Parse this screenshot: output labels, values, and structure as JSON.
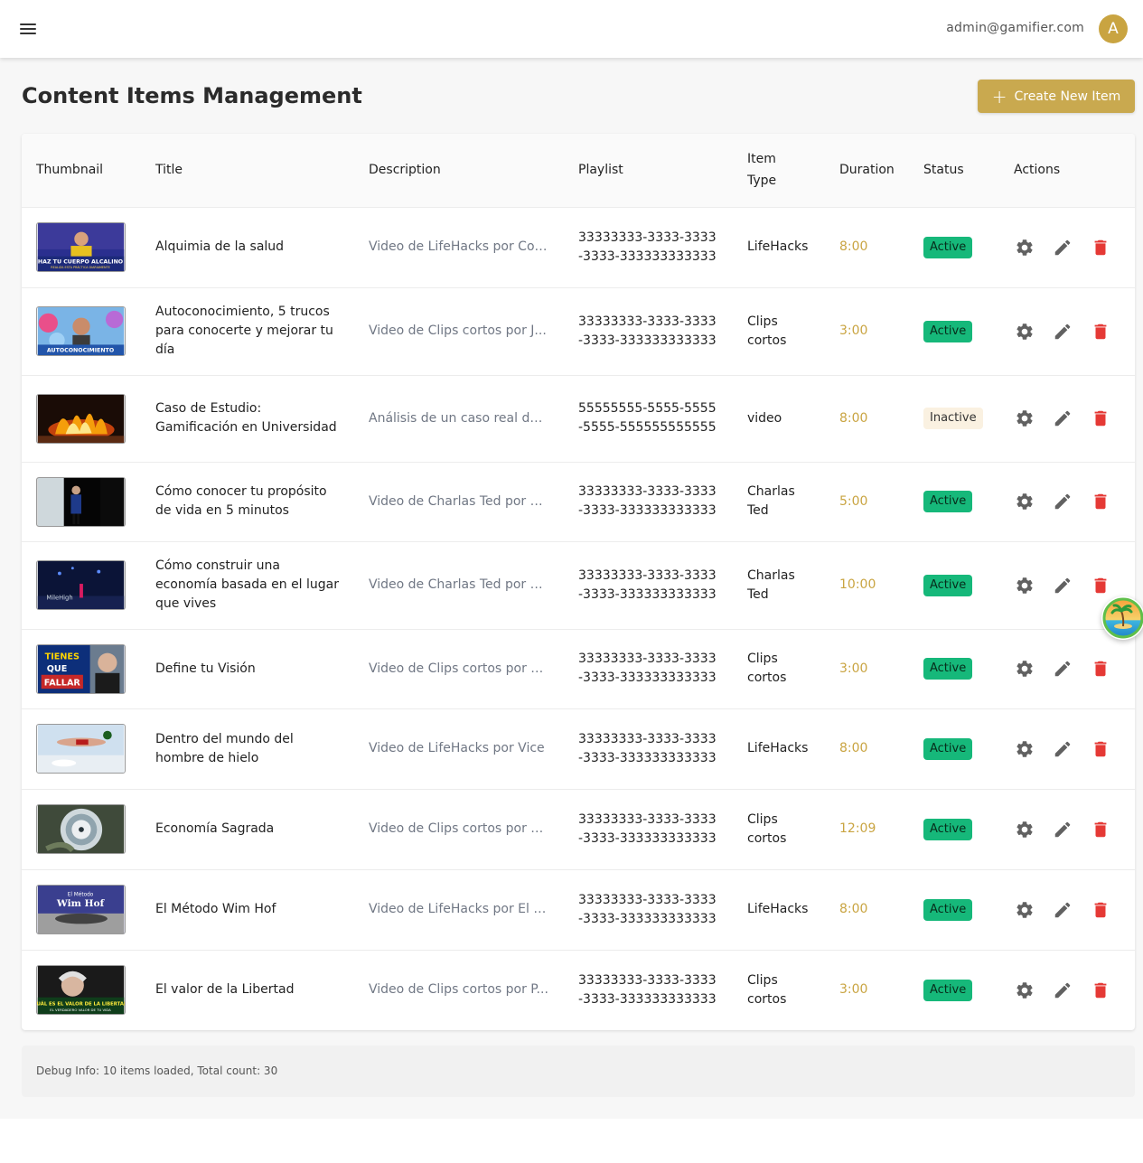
{
  "header": {
    "user_email": "admin@gamifier.com",
    "avatar_initial": "A",
    "menu_icon": "hamburger-menu-icon"
  },
  "page": {
    "title": "Content Items Management",
    "create_button_label": "Create New Item",
    "create_button_icon": "plus-icon"
  },
  "table": {
    "columns": [
      "Thumbnail",
      "Title",
      "Description",
      "Playlist",
      "Item Type",
      "Duration",
      "Status",
      "Actions"
    ],
    "actions_icons": [
      "gear-icon",
      "pencil-icon",
      "trash-icon"
    ],
    "rows": [
      {
        "title": "Alquimia de la salud",
        "description": "Video de LifeHacks por Con...",
        "playlist": "33333333-3333-3333-3333-333333333333",
        "item_type": "LifeHacks",
        "duration": "8:00",
        "status": "Active",
        "thumb_caption": "HAZ TU CUERPO ALCALINO"
      },
      {
        "title": "Autoconocimiento, 5 trucos para conocerte y mejorar tu día",
        "description": "Video de Clips cortos por J...",
        "playlist": "33333333-3333-3333-3333-333333333333",
        "item_type": "Clips cortos",
        "duration": "3:00",
        "status": "Active",
        "thumb_caption": "AUTOCONOCIMIENTO"
      },
      {
        "title": "Caso de Estudio: Gamificación en Universidad",
        "description": "Análisis de un caso real de ...",
        "playlist": "55555555-5555-5555-5555-555555555555",
        "item_type": "video",
        "duration": "8:00",
        "status": "Inactive",
        "thumb_caption": ""
      },
      {
        "title": "Cómo conocer tu propósito de vida en 5 minutos",
        "description": "Video de Charlas Ted por A...",
        "playlist": "33333333-3333-3333-3333-333333333333",
        "item_type": "Charlas Ted",
        "duration": "5:00",
        "status": "Active",
        "thumb_caption": ""
      },
      {
        "title": "Cómo construir una economía basada en el lugar que vives",
        "description": "Video de Charlas Ted por E...",
        "playlist": "33333333-3333-3333-3333-333333333333",
        "item_type": "Charlas Ted",
        "duration": "10:00",
        "status": "Active",
        "thumb_caption": "MileHigh"
      },
      {
        "title": "Define tu Visión",
        "description": "Video de Clips cortos por C...",
        "playlist": "33333333-3333-3333-3333-333333333333",
        "item_type": "Clips cortos",
        "duration": "3:00",
        "status": "Active",
        "thumb_caption": "TIENES QUE FALLAR"
      },
      {
        "title": "Dentro del mundo del hombre de hielo",
        "description": "Video de LifeHacks por Vice",
        "playlist": "33333333-3333-3333-3333-333333333333",
        "item_type": "LifeHacks",
        "duration": "8:00",
        "status": "Active",
        "thumb_caption": ""
      },
      {
        "title": "Economía Sagrada",
        "description": "Video de Clips cortos por C...",
        "playlist": "33333333-3333-3333-3333-333333333333",
        "item_type": "Clips cortos",
        "duration": "12:09",
        "status": "Active",
        "thumb_caption": ""
      },
      {
        "title": "El Método Wim Hof",
        "description": "Video de LifeHacks por El S...",
        "playlist": "33333333-3333-3333-3333-333333333333",
        "item_type": "LifeHacks",
        "duration": "8:00",
        "status": "Active",
        "thumb_caption": "Wim Hof"
      },
      {
        "title": "El valor de la Libertad",
        "description": "Video de Clips cortos por P...",
        "playlist": "33333333-3333-3333-3333-333333333333",
        "item_type": "Clips cortos",
        "duration": "3:00",
        "status": "Active",
        "thumb_caption": "¿CUÁL ES EL VALOR DE LA LIBERTAD?"
      }
    ]
  },
  "debug": {
    "text": "Debug Info: 10 items loaded, Total count: 30"
  },
  "colors": {
    "accent": "#c9a94f",
    "active_badge": "#16b87a",
    "inactive_badge": "#faf1e1",
    "delete": "#e53935",
    "icon_gray": "#616161"
  },
  "floating_widget": {
    "icon": "beach-island-icon"
  }
}
